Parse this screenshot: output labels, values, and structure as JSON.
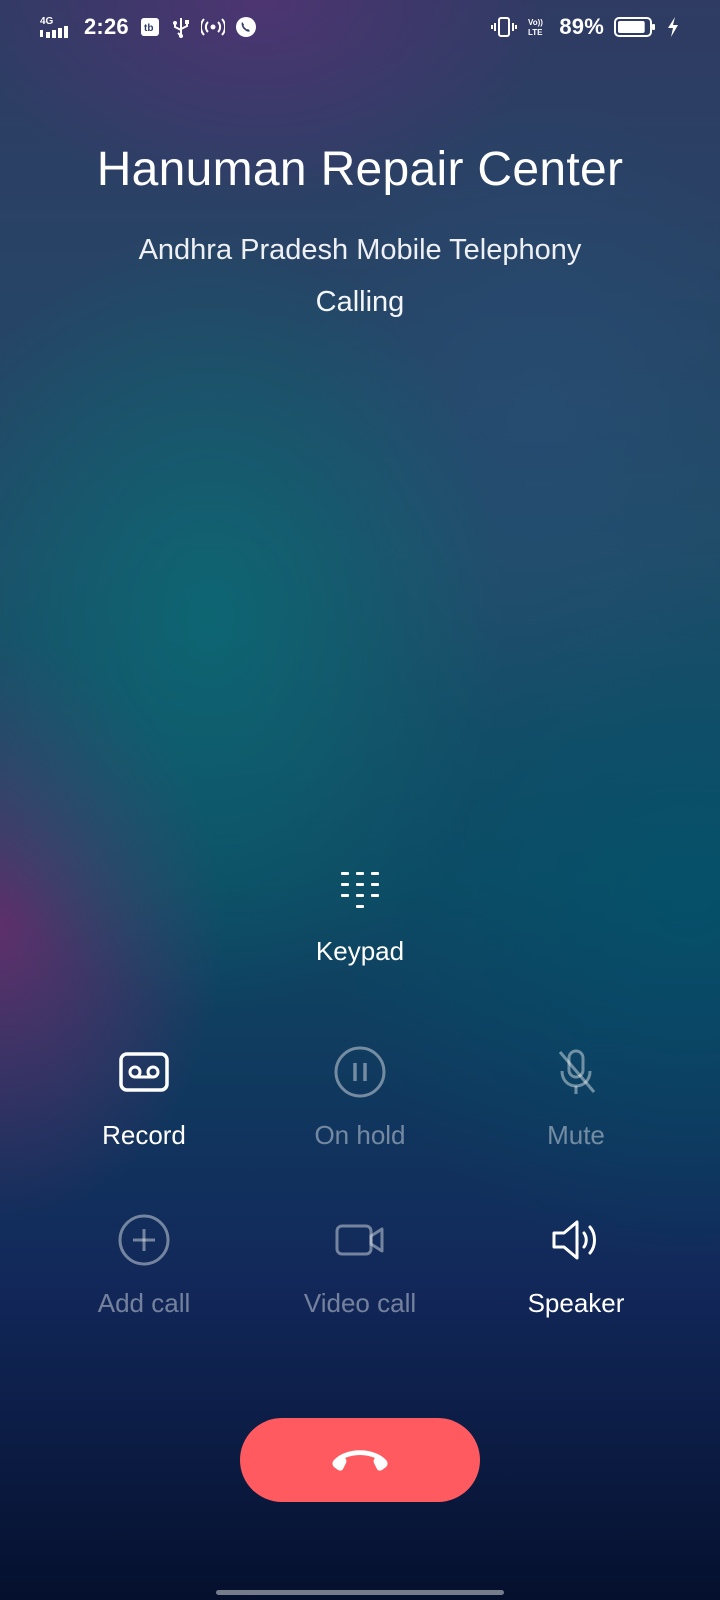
{
  "status_bar": {
    "network": "4G",
    "time": "2:26",
    "battery_percent": "89%",
    "volte_label": "Vo))\nLTE",
    "icons": [
      "signal-icon",
      "sim-icon",
      "usb-icon",
      "hotspot-icon",
      "call-active-icon",
      "vibrate-icon",
      "volte-icon",
      "battery-icon",
      "charging-icon"
    ],
    "battery_level": 0.89
  },
  "contact": {
    "name": "Hanuman Repair Center",
    "carrier": "Andhra Pradesh Mobile Telephony",
    "status": "Calling"
  },
  "keypad": {
    "label": "Keypad",
    "icon": "keypad-icon"
  },
  "controls": {
    "record": {
      "label": "Record",
      "icon": "record-icon",
      "enabled": true
    },
    "hold": {
      "label": "On hold",
      "icon": "pause-icon",
      "enabled": false
    },
    "mute": {
      "label": "Mute",
      "icon": "mic-off-icon",
      "enabled": false
    },
    "add_call": {
      "label": "Add call",
      "icon": "plus-icon",
      "enabled": false
    },
    "video_call": {
      "label": "Video call",
      "icon": "video-icon",
      "enabled": false
    },
    "speaker": {
      "label": "Speaker",
      "icon": "speaker-icon",
      "enabled": true
    }
  },
  "end_call": {
    "icon": "end-call-icon",
    "color": "#ff5a5f"
  },
  "colors": {
    "text": "#ffffff",
    "end_call": "#ff5a5f"
  }
}
